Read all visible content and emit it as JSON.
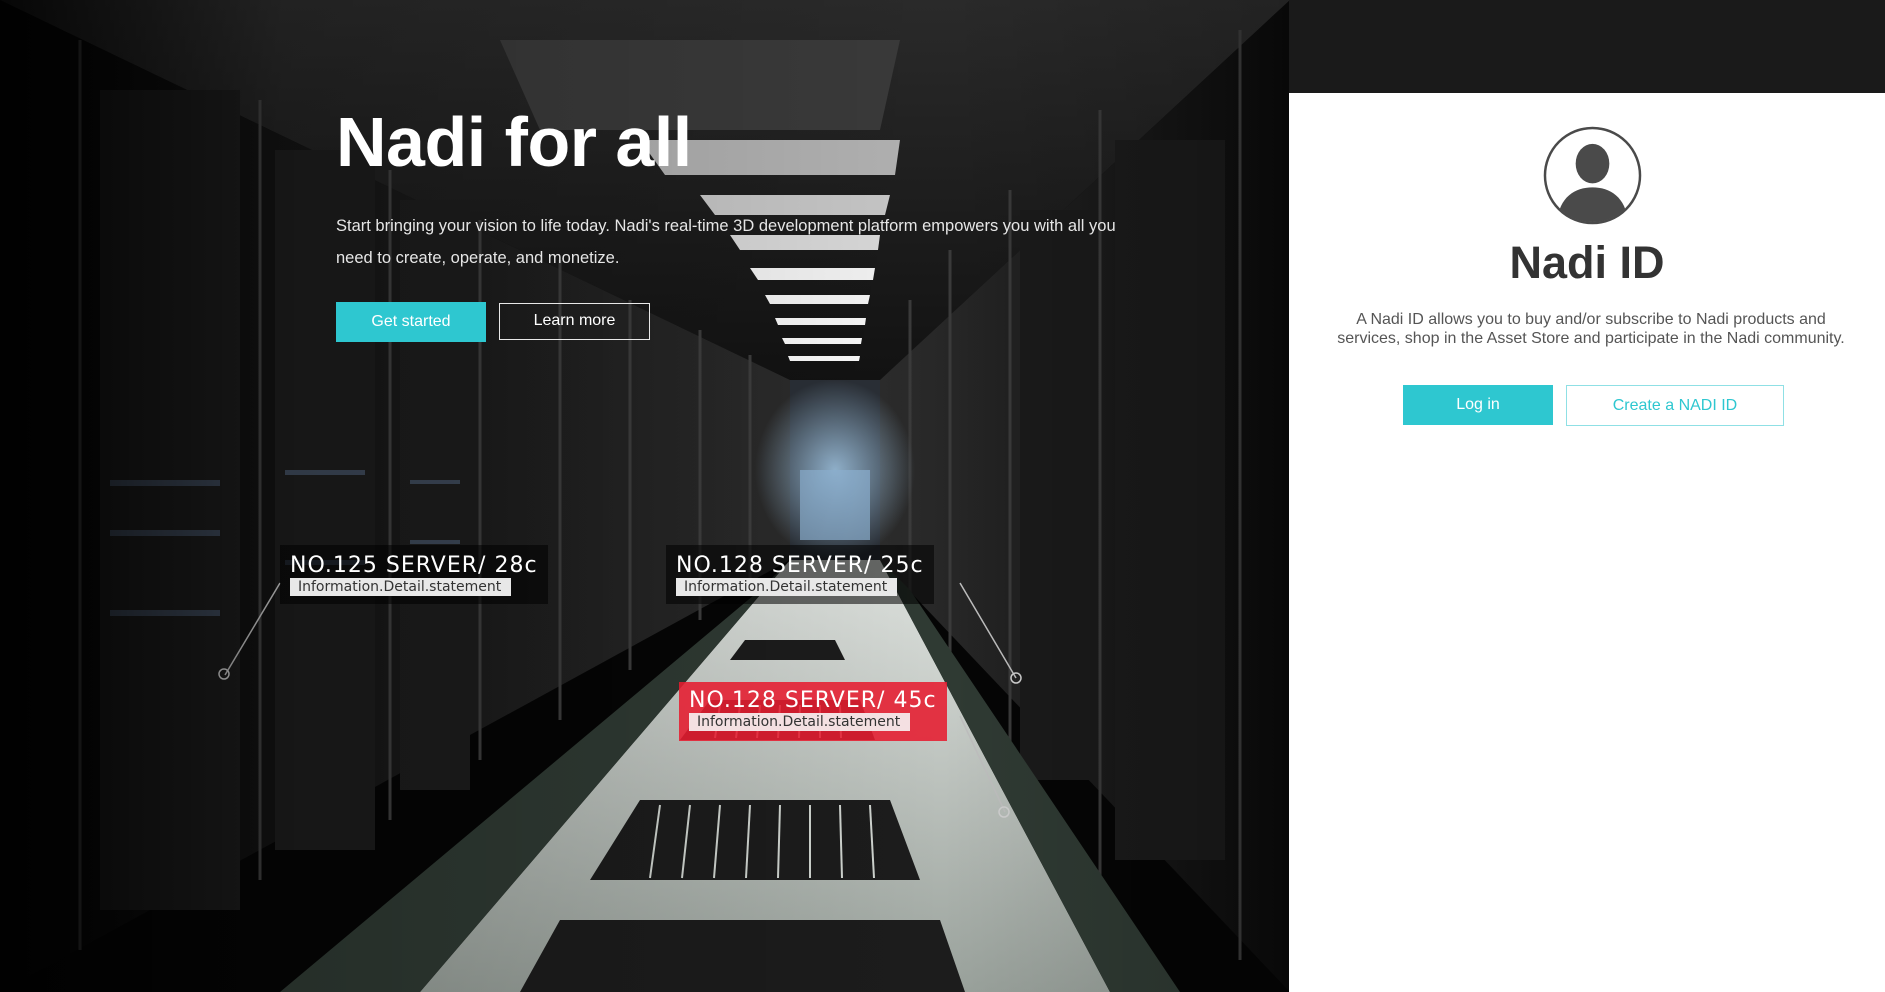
{
  "hero": {
    "title": "Nadi for all",
    "description": "Start bringing your vision to life today. Nadi's real-time 3D development platform empowers you with all you need to create, operate, and monetize.",
    "primary_button": "Get started",
    "secondary_button": "Learn more"
  },
  "server_tags": [
    {
      "title": "NO.125 SERVER/ 28c",
      "detail": "Information.Detail.statement",
      "status": "normal"
    },
    {
      "title": "NO.128 SERVER/ 25c",
      "detail": "Information.Detail.statement",
      "status": "normal"
    },
    {
      "title": "NO.128 SERVER/ 45c",
      "detail": "Information.Detail.statement",
      "status": "alert"
    }
  ],
  "account_panel": {
    "avatar_icon": "user-avatar-icon",
    "title": "Nadi ID",
    "description": "A Nadi ID allows you to buy and/or subscribe to Nadi products and services, shop in the Asset Store and participate in the Nadi community.",
    "login_button": "Log in",
    "create_button": "Create a NADI ID"
  },
  "colors": {
    "accent": "#2ec7d0",
    "alert": "#e61c30",
    "panel_background": "#ffffff"
  }
}
